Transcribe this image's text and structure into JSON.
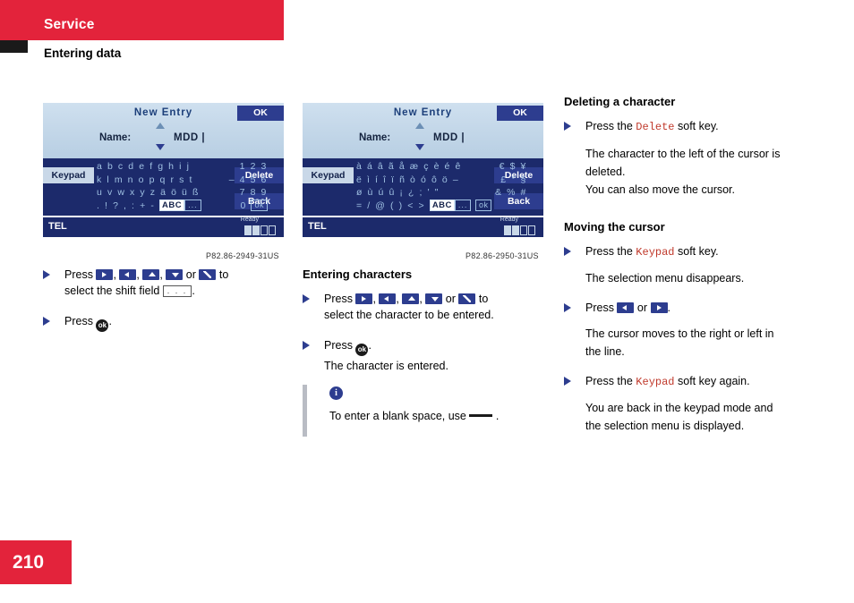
{
  "header": {
    "title": "Service",
    "subtitle": "Entering data"
  },
  "page_number": "210",
  "screens": [
    {
      "title": "New Entry",
      "ok_label": "OK",
      "name_label": "Name:",
      "name_value": "MDD |",
      "keypad_label": "Keypad",
      "delete_label": "Delete",
      "back_label": "Back",
      "tel_label": "TEL",
      "status_label": "Ready",
      "caption": "P82.86-2949-31US",
      "rows": [
        {
          "left": "a b c d e f g h i j",
          "right": "1 2 3"
        },
        {
          "left": "k l m n o p q r s t",
          "right": "– 4 5 6"
        },
        {
          "left": "u v w x y z ä ö ü ß",
          "right": "7 8 9"
        },
        {
          "left": ". ! ? , : + -",
          "right": "0"
        }
      ],
      "abc_box": "ABC",
      "dots_box": "...",
      "ok_box": "ok"
    },
    {
      "title": "New Entry",
      "ok_label": "OK",
      "name_label": "Name:",
      "name_value": "MDD |",
      "keypad_label": "Keypad",
      "delete_label": "Delete",
      "back_label": "Back",
      "tel_label": "TEL",
      "status_label": "Ready",
      "caption": "P82.86-2950-31US",
      "rows": [
        {
          "left": "à á â ã å æ ç è é ê",
          "right": "€ $ ¥"
        },
        {
          "left": "ë ì í î ï ñ ò ó ô ö –",
          "right": "£ ° §"
        },
        {
          "left": "ø ù ú û ¡ ¿ ; ' \"",
          "right": "& % #"
        },
        {
          "left": "= / @ ( ) < >",
          "right": ""
        }
      ],
      "abc_box": "ABC",
      "dots_box": "...",
      "ok_box": "ok"
    }
  ],
  "col1": {
    "step1_pre": "Press",
    "step1_mid": "or",
    "step1_post": "to",
    "step1_line2_pre": "select the shift field",
    "step1_line2_box": ". . .",
    "step1_line2_end": ".",
    "step2_pre": "Press",
    "step2_post": "."
  },
  "col2": {
    "heading": "Entering characters",
    "step1_pre": "Press",
    "step1_mid": "or",
    "step1_post": "to",
    "step1_line2": "select the character to be entered.",
    "step2_pre": "Press",
    "step2_post": ".",
    "step2_result": "The character is entered.",
    "note_icon": "i",
    "note_text_pre": "To enter a blank space, use",
    "note_text_post": "."
  },
  "col3": {
    "heading1": "Deleting a character",
    "d_step1_pre": "Press the",
    "d_step1_key": "Delete",
    "d_step1_post": "soft key.",
    "d_result_line1": "The character to the left of the cursor is",
    "d_result_line2": "deleted.",
    "d_result_line3": "You can also move the cursor.",
    "heading2": "Moving the cursor",
    "m_step1_pre": "Press the",
    "m_step1_key": "Keypad",
    "m_step1_post": "soft key.",
    "m_result1": "The selection menu disappears.",
    "m_step2_pre": "Press",
    "m_step2_mid": "or",
    "m_step2_post": ".",
    "m_result2_line1": "The cursor moves to the right or left in",
    "m_result2_line2": "the line.",
    "m_step3_pre": "Press the",
    "m_step3_key": "Keypad",
    "m_step3_post": "soft key again.",
    "m_result3_line1": "You are back in the keypad mode and",
    "m_result3_line2": "the selection menu is displayed."
  },
  "colors": {
    "accent_red": "#e3233b",
    "screen_blue": "#1c2a6b",
    "soft_key_blue": "#2d3d8f",
    "mono_red": "#c0392b"
  }
}
